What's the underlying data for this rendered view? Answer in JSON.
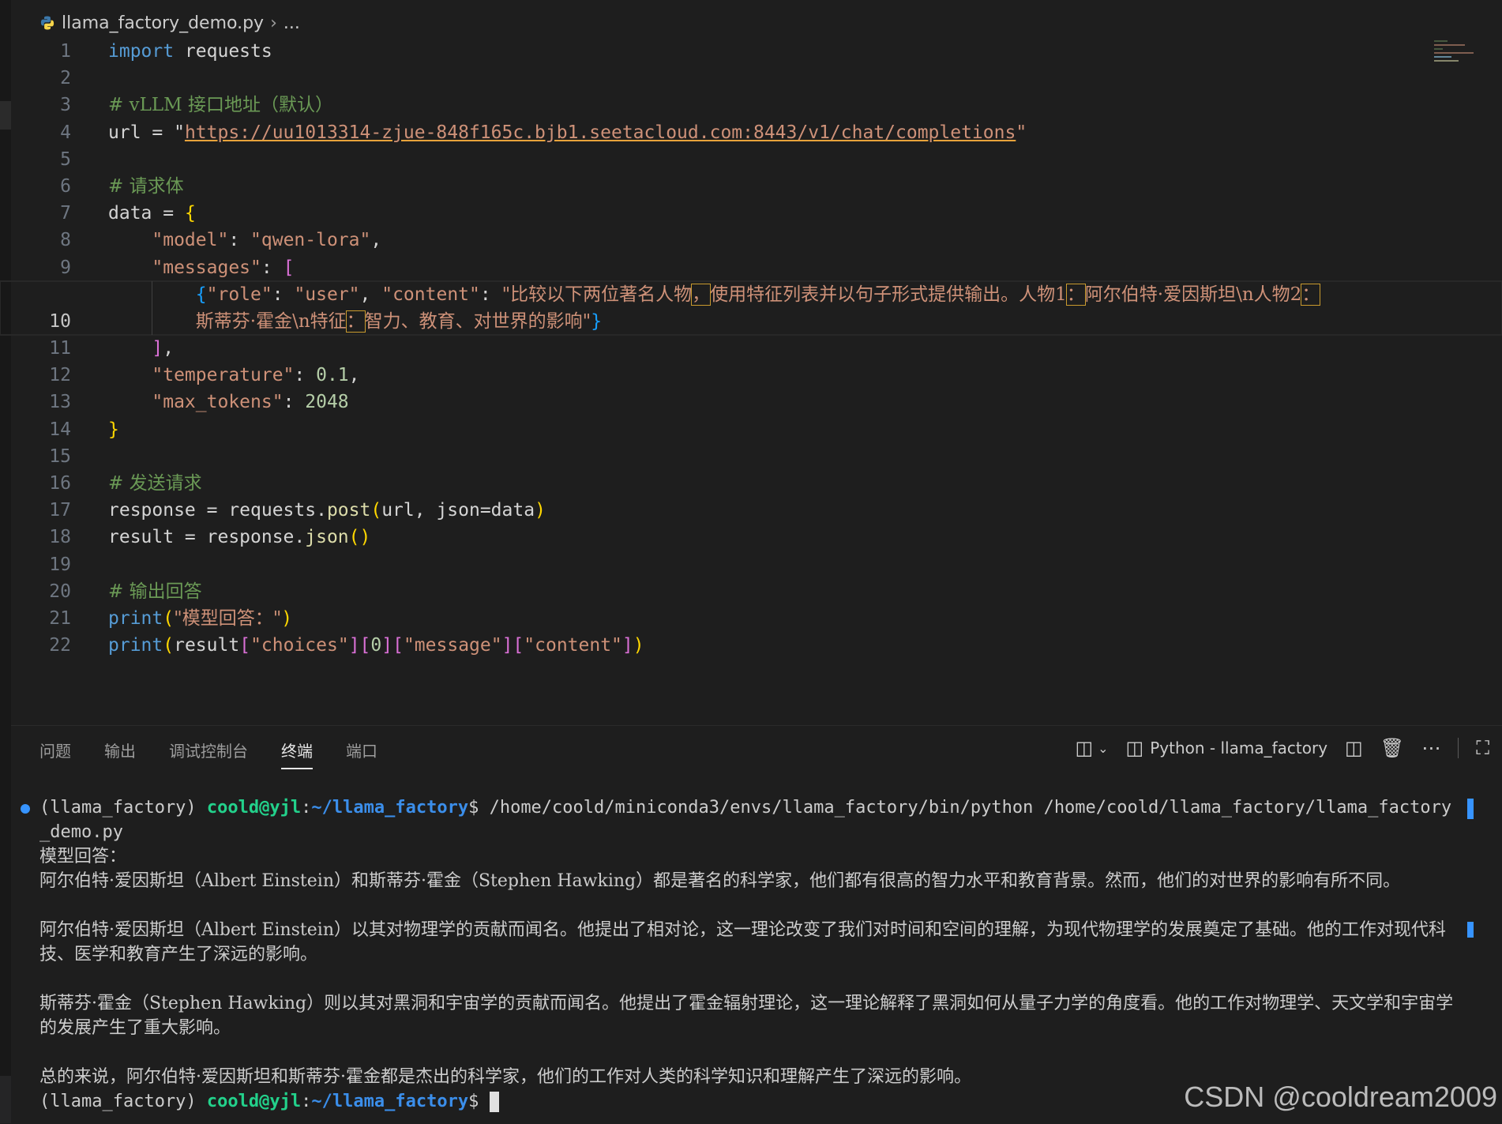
{
  "breadcrumb": {
    "file": "llama_factory_demo.py",
    "more": "..."
  },
  "editor": {
    "lines": [
      {
        "n": "1"
      },
      {
        "n": "2"
      },
      {
        "n": "3"
      },
      {
        "n": "4"
      },
      {
        "n": "5"
      },
      {
        "n": "6"
      },
      {
        "n": "7"
      },
      {
        "n": "8"
      },
      {
        "n": "9"
      },
      {
        "n": "10"
      },
      {
        "n": "11"
      },
      {
        "n": "12"
      },
      {
        "n": "13"
      },
      {
        "n": "14"
      },
      {
        "n": "15"
      },
      {
        "n": "16"
      },
      {
        "n": "17"
      },
      {
        "n": "18"
      },
      {
        "n": "19"
      },
      {
        "n": "20"
      },
      {
        "n": "21"
      },
      {
        "n": "22"
      }
    ],
    "code": {
      "l1_kw": "import",
      "l1_rest": " requests",
      "l3": "# vLLM 接口地址（默认）",
      "l4_pre": "url = \"",
      "l4_url": "https://uu1013314-zjue-848f165c.bjb1.seetacloud.com:8443/v1/chat/completions",
      "l4_post": "\"",
      "l6": "# 请求体",
      "l7_pre": "data = ",
      "l7_b": "{",
      "l8_key": "\"model\"",
      "l8_colon": ": ",
      "l8_val": "\"qwen-lora\"",
      "l8_end": ",",
      "l9_key": "\"messages\"",
      "l9_colon": ": ",
      "l9_b": "[",
      "l10_open": "{",
      "l10_k1": "\"role\"",
      "l10_c1": ": ",
      "l10_v1": "\"user\"",
      "l10_sep": ", ",
      "l10_k2": "\"content\"",
      "l10_c2": ": ",
      "l10_s1": "\"比较以下两位著名人物",
      "l10_h1": "，",
      "l10_s2": "使用特征列表并以句子形式提供输出。人物1",
      "l10_h2": "：",
      "l10_s3": "阿尔伯特·爱因斯坦\\n人物2",
      "l10_h3": "：",
      "l10_w1": "斯蒂芬·霍金\\n特征",
      "l10_h4": "：",
      "l10_w2": "智力、教育、对世界的影响\"",
      "l10_close": "}",
      "l11_b": "]",
      "l11_end": ",",
      "l12_key": "\"temperature\"",
      "l12_colon": ": ",
      "l12_val": "0.1",
      "l12_end": ",",
      "l13_key": "\"max_tokens\"",
      "l13_colon": ": ",
      "l13_val": "2048",
      "l14_b": "}",
      "l16": "# 发送请求",
      "l17_pre": "response = requests.",
      "l17_fn": "post",
      "l17_o": "(",
      "l17_args": "url, json=data",
      "l17_c": ")",
      "l18_pre": "result = response.",
      "l18_fn": "json",
      "l18_b": "()",
      "l20": "# 输出回答",
      "l21_fn": "print",
      "l21_o": "(",
      "l21_s": "\"模型回答：\"",
      "l21_c": ")",
      "l22_fn": "print",
      "l22_o": "(",
      "l22_a": "result",
      "l22_b1": "[",
      "l22_s1": "\"choices\"",
      "l22_b2": "][",
      "l22_n": "0",
      "l22_b3": "][",
      "l22_s2": "\"message\"",
      "l22_b4": "][",
      "l22_s3": "\"content\"",
      "l22_b5": "]",
      "l22_c": ")"
    }
  },
  "panel": {
    "tabs": [
      "问题",
      "输出",
      "调试控制台",
      "终端",
      "端口"
    ],
    "active_tab": "终端",
    "terminal_name": "Python - llama_factory"
  },
  "terminal": {
    "env": "(llama_factory) ",
    "user_host": "coold@yjl",
    "colon": ":",
    "path": "~/llama_factory",
    "prompt_end": "$ ",
    "command": "/home/coold/miniconda3/envs/llama_factory/bin/python /home/coold/llama_factory/llama_factory_demo.py",
    "output": [
      "模型回答：",
      "阿尔伯特·爱因斯坦（Albert Einstein）和斯蒂芬·霍金（Stephen Hawking）都是著名的科学家，他们都有很高的智力水平和教育背景。然而，他们的对世界的影响有所不同。",
      "",
      "阿尔伯特·爱因斯坦（Albert Einstein）以其对物理学的贡献而闻名。他提出了相对论，这一理论改变了我们对时间和空间的理解，为现代物理学的发展奠定了基础。他的工作对现代科技、医学和教育产生了深远的影响。",
      "",
      "斯蒂芬·霍金（Stephen Hawking）则以其对黑洞和宇宙学的贡献而闻名。他提出了霍金辐射理论，这一理论解释了黑洞如何从量子力学的角度看。他的工作对物理学、天文学和宇宙学的发展产生了重大影响。",
      "",
      "总的来说，阿尔伯特·爱因斯坦和斯蒂芬·霍金都是杰出的科学家，他们的工作对人类的科学知识和理解产生了深远的影响。"
    ]
  },
  "watermark": "CSDN @cooldream2009",
  "colors": {
    "keyword": "#569cd6",
    "string": "#ce9178",
    "comment": "#6a9955",
    "number": "#b5cea8",
    "accent": "#3794ff"
  }
}
